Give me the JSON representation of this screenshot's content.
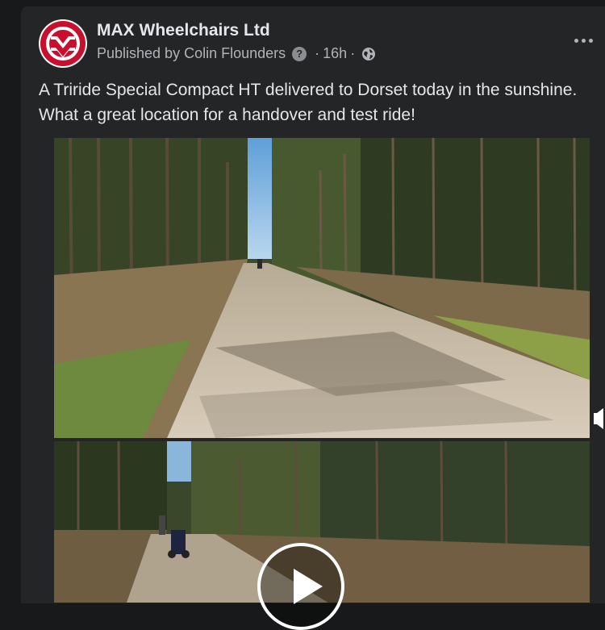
{
  "post": {
    "page_name": "MAX Wheelchairs Ltd",
    "published_by": "Published by Colin Flounders",
    "help_glyph": "?",
    "time_ago": "16h",
    "separator": "·",
    "privacy_icon": "globe-icon",
    "more_icon": "more-options-icon",
    "text": "A Triride Special Compact HT delivered to Dorset today in the sunshine. What a great location for a handover and test ride!"
  },
  "media": {
    "video_controls": {
      "mute_icon": "speaker-muted-icon",
      "play_icon": "play-icon"
    }
  },
  "colors": {
    "background": "#18191a",
    "card": "#242526",
    "text_primary": "#e4e6eb",
    "text_secondary": "#b0b3b8",
    "brand_red": "#c8102e"
  }
}
